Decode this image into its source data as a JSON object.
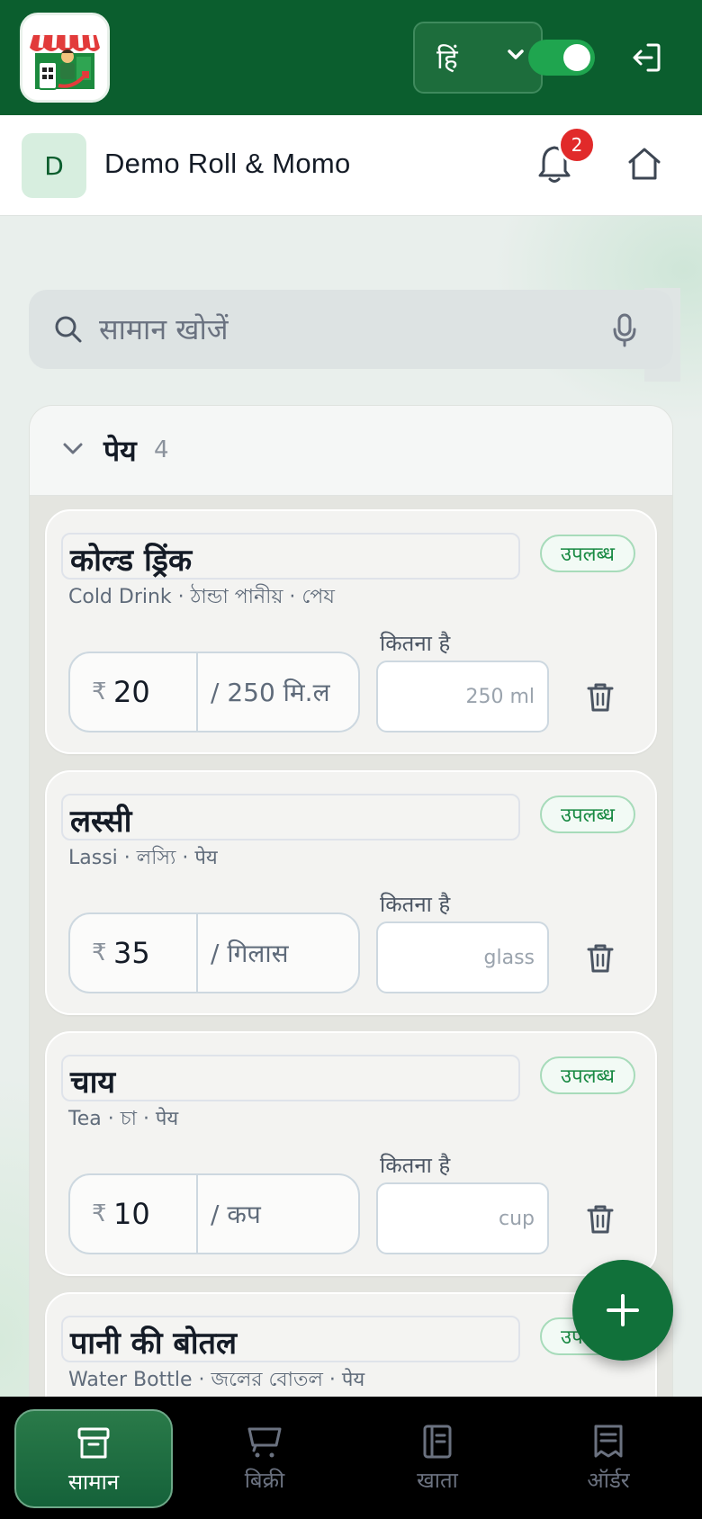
{
  "header": {
    "logo_name": "shop-logo",
    "language": "हिं",
    "online_toggle": "on",
    "accent": "#0b5e2e"
  },
  "shop": {
    "avatar_letter": "D",
    "name": "Demo Roll & Momo",
    "notification_count": "2"
  },
  "search": {
    "placeholder": "सामान खोजें"
  },
  "category": {
    "name": "पेय",
    "count": "4"
  },
  "items": [
    {
      "name": "कोल्ड ड्रिंक",
      "status": "उपलब्ध",
      "subtitle": "Cold Drink · ঠান্ডা পানীয় · পেয",
      "currency": "₹",
      "price": "20",
      "unit": "/ 250 मि.ल",
      "qty_label": "कितना है",
      "qty_placeholder": "250 ml"
    },
    {
      "name": "लस्सी",
      "status": "उपलब्ध",
      "subtitle": "Lassi · লস্যি · पेय",
      "currency": "₹",
      "price": "35",
      "unit": "/ गिलास",
      "qty_label": "कितना है",
      "qty_placeholder": "glass"
    },
    {
      "name": "चाय",
      "status": "उपलब्ध",
      "subtitle": "Tea · চা · पेय",
      "currency": "₹",
      "price": "10",
      "unit": "/ कप",
      "qty_label": "कितना है",
      "qty_placeholder": "cup"
    },
    {
      "name": "पानी की बोतल",
      "status": "उपलब्ध",
      "subtitle": "Water Bottle · জলের বোতল · पेय"
    }
  ],
  "bottom_nav": [
    {
      "label": "सामान",
      "icon": "box-icon",
      "active": true
    },
    {
      "label": "बिक्री",
      "icon": "cart-icon",
      "active": false
    },
    {
      "label": "खाता",
      "icon": "ledger-icon",
      "active": false
    },
    {
      "label": "ऑर्डर",
      "icon": "receipt-icon",
      "active": false
    }
  ]
}
